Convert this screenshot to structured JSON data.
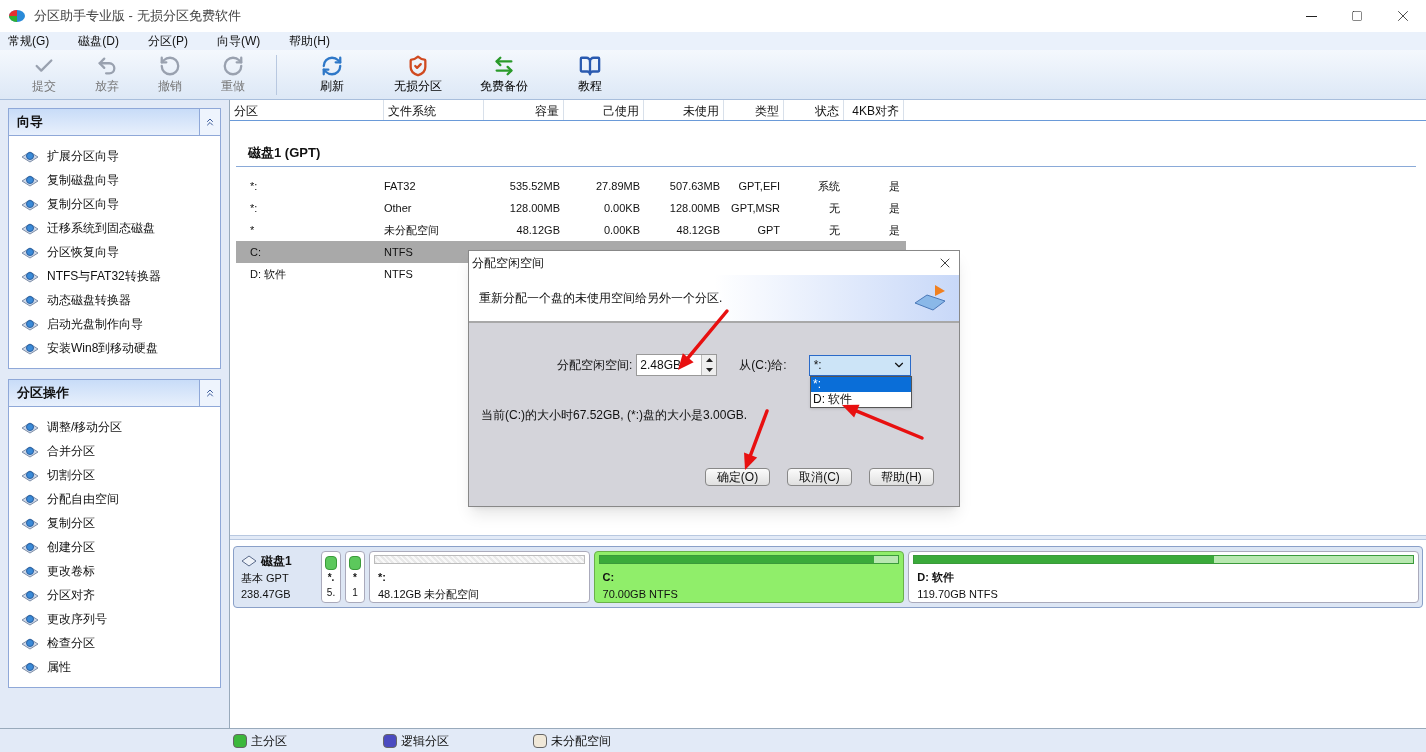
{
  "window": {
    "title": "分区助手专业版 - 无损分区免费软件"
  },
  "menu": [
    "常规(G)",
    "磁盘(D)",
    "分区(P)",
    "向导(W)",
    "帮助(H)"
  ],
  "toolbar": [
    {
      "label": "提交",
      "kind": "check",
      "disabled": true
    },
    {
      "label": "放弃",
      "kind": "discard",
      "disabled": true
    },
    {
      "label": "撤销",
      "kind": "undo",
      "disabled": true
    },
    {
      "label": "重做",
      "kind": "redo",
      "disabled": true
    },
    {
      "label": "刷新",
      "kind": "refresh",
      "disabled": false
    },
    {
      "label": "无损分区",
      "kind": "shield",
      "disabled": false
    },
    {
      "label": "免费备份",
      "kind": "backup",
      "disabled": false
    },
    {
      "label": "教程",
      "kind": "book",
      "disabled": false
    }
  ],
  "sidebar": [
    {
      "title": "向导",
      "items": [
        "扩展分区向导",
        "复制磁盘向导",
        "复制分区向导",
        "迁移系统到固态磁盘",
        "分区恢复向导",
        "NTFS与FAT32转换器",
        "动态磁盘转换器",
        "启动光盘制作向导",
        "安装Win8到移动硬盘"
      ]
    },
    {
      "title": "分区操作",
      "items": [
        "调整/移动分区",
        "合并分区",
        "切割分区",
        "分配自由空间",
        "复制分区",
        "创建分区",
        "更改卷标",
        "分区对齐",
        "更改序列号",
        "检查分区",
        "属性"
      ]
    }
  ],
  "table": {
    "columns": [
      "分区",
      "文件系统",
      "容量",
      "己使用",
      "未使用",
      "类型",
      "状态",
      "4KB对齐"
    ],
    "group": "磁盘1 (GPT)",
    "rows": [
      {
        "selected": false,
        "cells": [
          "*:",
          "FAT32",
          "535.52MB",
          "27.89MB",
          "507.63MB",
          "GPT,EFI",
          "系统",
          "是"
        ]
      },
      {
        "selected": false,
        "cells": [
          "*:",
          "Other",
          "128.00MB",
          "0.00KB",
          "128.00MB",
          "GPT,MSR",
          "无",
          "是"
        ]
      },
      {
        "selected": false,
        "cells": [
          "*",
          "未分配空间",
          "48.12GB",
          "0.00KB",
          "48.12GB",
          "GPT",
          "无",
          "是"
        ]
      },
      {
        "selected": true,
        "cells": [
          "C:",
          "NTFS"
        ]
      },
      {
        "selected": false,
        "cells": [
          "D: 软件",
          "NTFS"
        ]
      }
    ]
  },
  "disk_map": {
    "disk": {
      "name": "磁盘1",
      "type": "基本 GPT",
      "size": "238.47GB"
    },
    "partitions": [
      {
        "kind": "small",
        "name": "*.",
        "detail": "5."
      },
      {
        "kind": "small",
        "name": "*",
        "detail": "1"
      },
      {
        "kind": "unallocated",
        "name": "*:",
        "detail": "48.12GB 未分配空间",
        "selected": false
      },
      {
        "kind": "primary",
        "name": "C:",
        "detail": "70.00GB NTFS",
        "level": 0.92,
        "selected": true
      },
      {
        "kind": "primary",
        "name": "D: 软件",
        "detail": "119.70GB NTFS",
        "level": 0.6,
        "selected": false
      }
    ]
  },
  "legend": [
    {
      "label": "主分区",
      "color": "#3cb83c"
    },
    {
      "label": "逻辑分区",
      "color": "#4a4ac0"
    },
    {
      "label": "未分配空间",
      "color": "#f0e8d8"
    }
  ],
  "dialog": {
    "title": "分配空闲空间",
    "description": "重新分配一个盘的未使用空间给另外一个分区.",
    "size_field": {
      "label": "分配空闲空间:",
      "value": "2.48GB"
    },
    "from_field": {
      "label": "从(C:)给:",
      "value": "*:",
      "options": [
        {
          "label": "*:",
          "selected": true
        },
        {
          "label": "D: 软件",
          "selected": false
        }
      ]
    },
    "info": "当前(C:)的大小时67.52GB, (*:)盘的大小是3.00GB.",
    "buttons": [
      "确定(O)",
      "取消(C)",
      "帮助(H)"
    ]
  }
}
